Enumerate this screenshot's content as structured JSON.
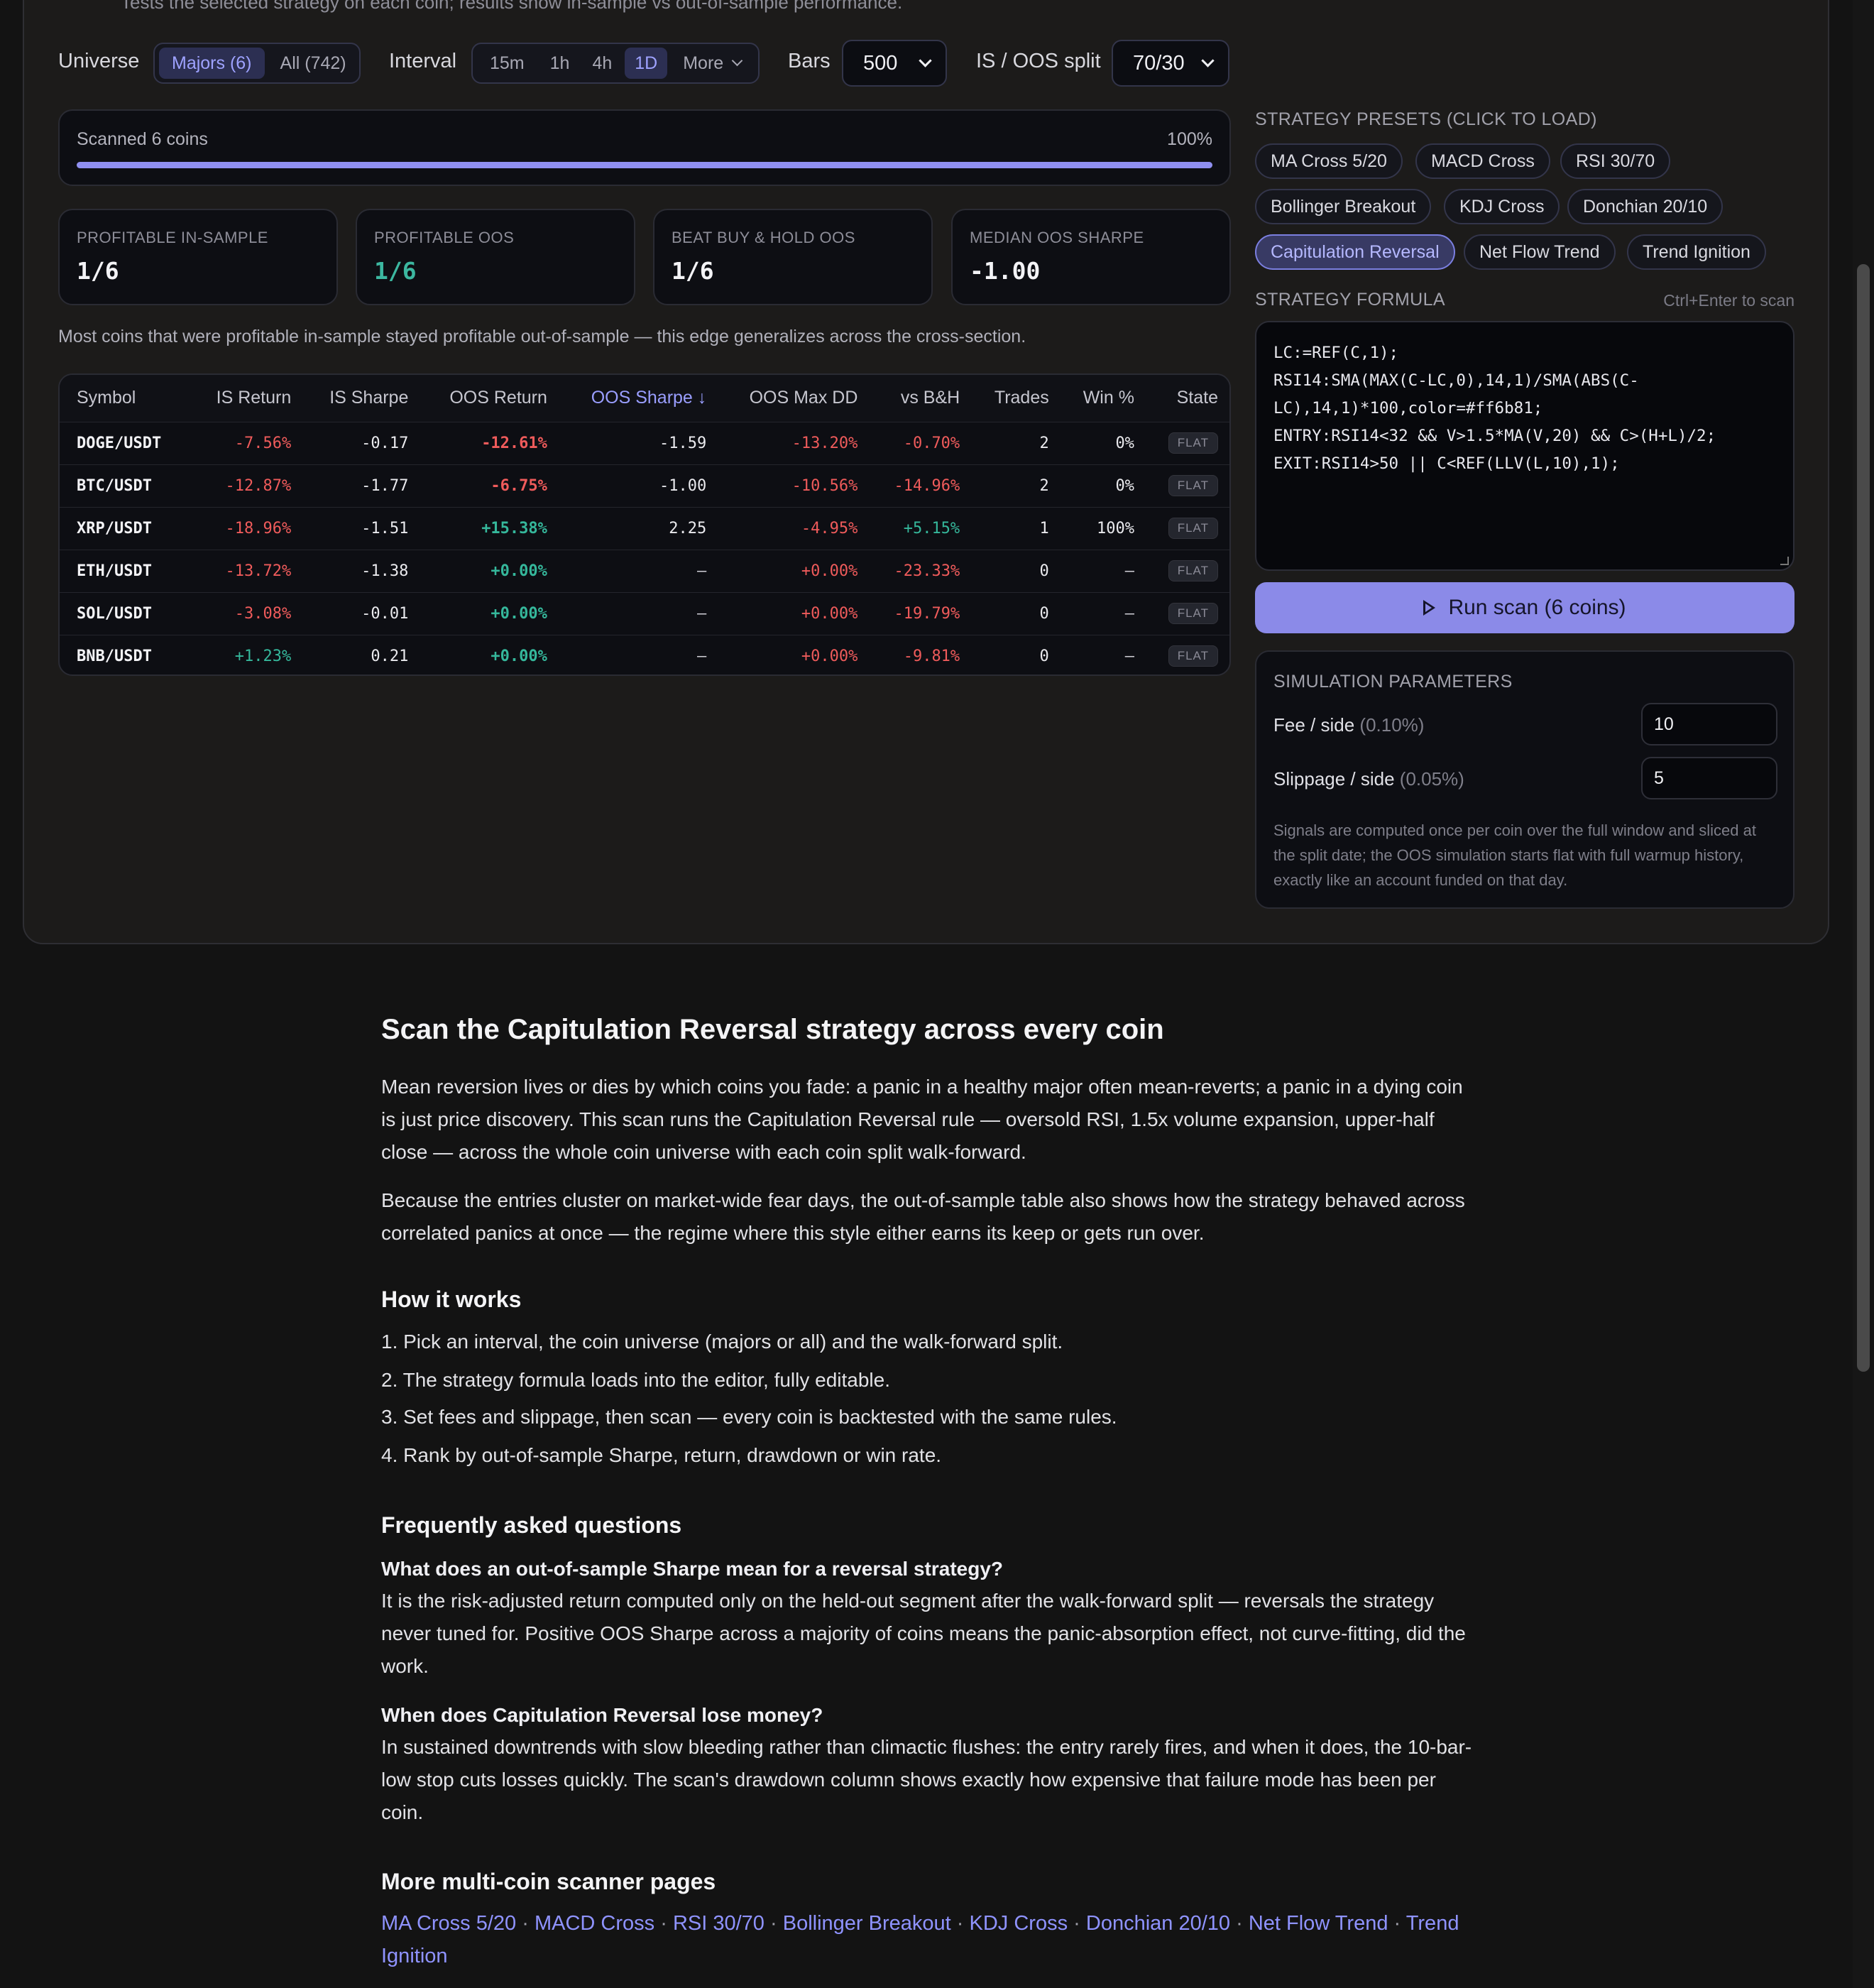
{
  "top_text": "Tests the selected strategy on each coin; results show in-sample vs out-of-sample performance.",
  "controls": {
    "universe_label": "Universe",
    "universe_options": [
      "Majors (6)",
      "All (742)"
    ],
    "universe_selected": "Majors (6)",
    "interval_label": "Interval",
    "interval_options": [
      "15m",
      "1h",
      "4h",
      "1D",
      "More"
    ],
    "interval_selected": "1D",
    "bars_label": "Bars",
    "bars_value": "500",
    "split_label": "IS / OOS split",
    "split_value": "70/30"
  },
  "progress": {
    "label": "Scanned 6 coins",
    "percent_text": "100%",
    "percent": 100
  },
  "stats": [
    {
      "title": "PROFITABLE IN-SAMPLE",
      "value": "1/6"
    },
    {
      "title": "PROFITABLE OOS",
      "value": "1/6"
    },
    {
      "title": "BEAT BUY & HOLD OOS",
      "value": "1/6"
    },
    {
      "title": "MEDIAN OOS SHARPE",
      "value": "-1.00"
    }
  ],
  "summary_note": "Most coins that were profitable in-sample stayed profitable out-of-sample — this edge generalizes across the cross-section.",
  "table": {
    "headers": [
      "Symbol",
      "IS Return",
      "IS Sharpe",
      "OOS Return",
      "OOS Sharpe ↓",
      "OOS Max DD",
      "vs B&H",
      "Trades",
      "Win %",
      "State"
    ],
    "rows": [
      [
        "DOGE/USDT",
        "-7.56%",
        "-0.17",
        "-12.61%",
        "-1.59",
        "-13.20%",
        "-0.70%",
        "2",
        "0%",
        "FLAT"
      ],
      [
        "BTC/USDT",
        "-12.87%",
        "-1.77",
        "-6.75%",
        "-1.00",
        "-10.56%",
        "-14.96%",
        "2",
        "0%",
        "FLAT"
      ],
      [
        "XRP/USDT",
        "-18.96%",
        "-1.51",
        "+15.38%",
        "2.25",
        "-4.95%",
        "+5.15%",
        "1",
        "100%",
        "FLAT"
      ],
      [
        "ETH/USDT",
        "-13.72%",
        "-1.38",
        "+0.00%",
        "—",
        "+0.00%",
        "-23.33%",
        "0",
        "—",
        "FLAT"
      ],
      [
        "SOL/USDT",
        "-3.08%",
        "-0.01",
        "+0.00%",
        "—",
        "+0.00%",
        "-19.79%",
        "0",
        "—",
        "FLAT"
      ],
      [
        "BNB/USDT",
        "+1.23%",
        "0.21",
        "+0.00%",
        "—",
        "+0.00%",
        "-9.81%",
        "0",
        "—",
        "FLAT"
      ]
    ]
  },
  "presets": {
    "title": "STRATEGY PRESETS (CLICK TO LOAD)",
    "items": [
      "MA Cross 5/20",
      "MACD Cross",
      "RSI 30/70",
      "Bollinger Breakout",
      "KDJ Cross",
      "Donchian 20/10",
      "Capitulation Reversal",
      "Net Flow Trend",
      "Trend Ignition"
    ],
    "active": "Capitulation Reversal"
  },
  "formula": {
    "title": "STRATEGY FORMULA",
    "hint": "Ctrl+Enter to scan",
    "code": "LC:=REF(C,1);\nRSI14:SMA(MAX(C-LC,0),14,1)/SMA(ABS(C-\nLC),14,1)*100,color=#ff6b81;\nENTRY:RSI14<32 && V>1.5*MA(V,20) && C>(H+L)/2;\nEXIT:RSI14>50 || C<REF(LLV(L,10),1);"
  },
  "run_button": "Run scan (6 coins)",
  "simulation": {
    "title": "SIMULATION PARAMETERS",
    "fee_label": "Fee / side",
    "fee_hint": "(0.10%)",
    "fee_value": "10",
    "slippage_label": "Slippage / side",
    "slippage_hint": "(0.05%)",
    "slippage_value": "5",
    "note": "Signals are computed once per coin over the full window and sliced at the split date; the OOS simulation starts flat with full warmup history, exactly like an account funded on that day."
  },
  "article": {
    "title": "Scan the Capitulation Reversal strategy across every coin",
    "p1": "Mean reversion lives or dies by which coins you fade: a panic in a healthy major often mean-reverts; a panic in a dying coin is just price discovery. This scan runs the Capitulation Reversal rule — oversold RSI, 1.5x volume expansion, upper-half close — across the whole coin universe with each coin split walk-forward.",
    "p2": "Because the entries cluster on market-wide fear days, the out-of-sample table also shows how the strategy behaved across correlated panics at once — the regime where this style either earns its keep or gets run over.",
    "how_title": "How it works",
    "steps": [
      "1. Pick an interval, the coin universe (majors or all) and the walk-forward split.",
      "2. The strategy formula loads into the editor, fully editable.",
      "3. Set fees and slippage, then scan — every coin is backtested with the same rules.",
      "4. Rank by out-of-sample Sharpe, return, drawdown or win rate."
    ],
    "faq_title": "Frequently asked questions",
    "q1": "What does an out-of-sample Sharpe mean for a reversal strategy?",
    "a1": "It is the risk-adjusted return computed only on the held-out segment after the walk-forward split — reversals the strategy never tuned for. Positive OOS Sharpe across a majority of coins means the panic-absorption effect, not curve-fitting, did the work.",
    "q2": "When does Capitulation Reversal lose money?",
    "a2": "In sustained downtrends with slow bleeding rather than climactic flushes: the entry rarely fires, and when it does, the 10-bar-low stop cuts losses quickly. The scan's drawdown column shows exactly how expensive that failure mode has been per coin.",
    "more_title": "More multi-coin scanner pages",
    "more_links": [
      "MA Cross 5/20",
      "MACD Cross",
      "RSI 30/70",
      "Bollinger Breakout",
      "KDJ Cross",
      "Donchian 20/10",
      "Net Flow Trend",
      "Trend Ignition"
    ]
  }
}
